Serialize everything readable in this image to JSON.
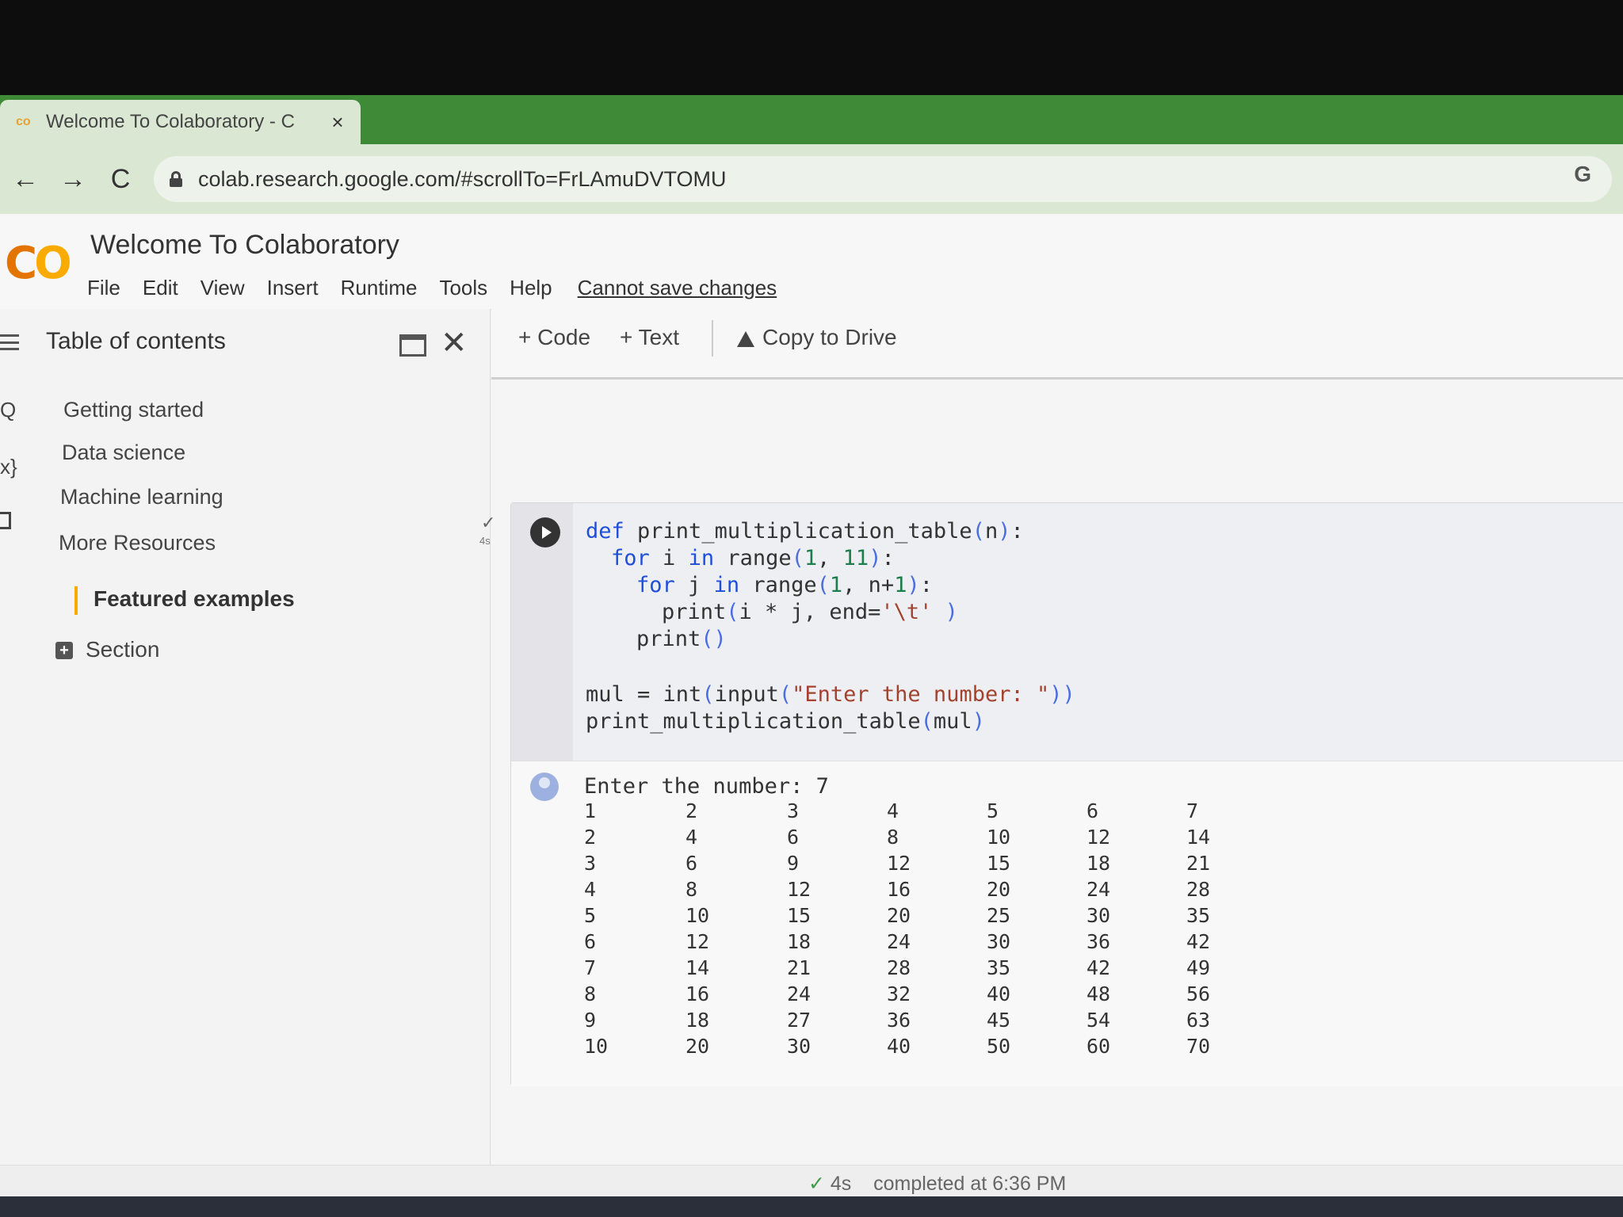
{
  "browser": {
    "tab_title": "Welcome To Colaboratory - C",
    "tab_close": "×",
    "url": "colab.research.google.com/#scrollTo=FrLAmuDVTOMU",
    "back": "←",
    "forward": "→",
    "reload": "C",
    "profile_letter": "G"
  },
  "colab": {
    "logo": "CO",
    "title": "Welcome To Colaboratory",
    "menu": [
      "File",
      "Edit",
      "View",
      "Insert",
      "Runtime",
      "Tools",
      "Help"
    ],
    "save_notice": "Cannot save changes"
  },
  "sidebar": {
    "title": "Table of contents",
    "close": "✕",
    "rail_search": "Q",
    "rail_code": "x}",
    "items": [
      "Getting started",
      "Data science",
      "Machine learning",
      "More Resources"
    ],
    "featured": "Featured examples",
    "section_plus": "+",
    "section": "Section"
  },
  "toolbar": {
    "code": "+ Code",
    "text": "+ Text",
    "copy_to_drive": "Copy to Drive"
  },
  "cell": {
    "check": "✓",
    "exec_time": "4s",
    "input_line": "Enter the number: 7",
    "table": [
      [
        "1",
        "2",
        "3",
        "4",
        "5",
        "6",
        "7"
      ],
      [
        "2",
        "4",
        "6",
        "8",
        "10",
        "12",
        "14"
      ],
      [
        "3",
        "6",
        "9",
        "12",
        "15",
        "18",
        "21"
      ],
      [
        "4",
        "8",
        "12",
        "16",
        "20",
        "24",
        "28"
      ],
      [
        "5",
        "10",
        "15",
        "20",
        "25",
        "30",
        "35"
      ],
      [
        "6",
        "12",
        "18",
        "24",
        "30",
        "36",
        "42"
      ],
      [
        "7",
        "14",
        "21",
        "28",
        "35",
        "42",
        "49"
      ],
      [
        "8",
        "16",
        "24",
        "32",
        "40",
        "48",
        "56"
      ],
      [
        "9",
        "18",
        "27",
        "36",
        "45",
        "54",
        "63"
      ],
      [
        "10",
        "20",
        "30",
        "40",
        "50",
        "60",
        "70"
      ]
    ]
  },
  "status": {
    "check": "✓",
    "duration": "4s",
    "completed": "completed at 6:36 PM"
  },
  "colors": {
    "tabstrip": "#3f8a36",
    "logo_orange": "#e37400",
    "logo_yellow": "#f9ab00",
    "keyword_blue": "#1f4fd8"
  }
}
